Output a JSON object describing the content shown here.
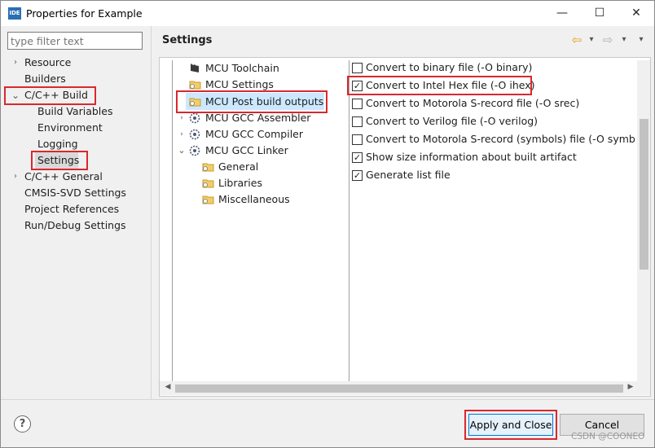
{
  "window": {
    "title": "Properties for Example",
    "app_icon": "IDE",
    "minimize_glyph": "—",
    "maximize_glyph": "☐",
    "close_glyph": "✕"
  },
  "filter": {
    "placeholder": "type filter text"
  },
  "left_nav": [
    {
      "label": "Resource",
      "arrow": "›"
    },
    {
      "label": "Builders",
      "arrow": ""
    },
    {
      "label": "C/C++ Build",
      "arrow": "⌄"
    },
    {
      "label": "Build Variables",
      "arrow": ""
    },
    {
      "label": "Environment",
      "arrow": ""
    },
    {
      "label": "Logging",
      "arrow": ""
    },
    {
      "label": "Settings",
      "arrow": ""
    },
    {
      "label": "C/C++ General",
      "arrow": "›"
    },
    {
      "label": "CMSIS-SVD Settings",
      "arrow": ""
    },
    {
      "label": "Project References",
      "arrow": ""
    },
    {
      "label": "Run/Debug Settings",
      "arrow": ""
    }
  ],
  "settings": {
    "title": "Settings",
    "back_glyph": "⇦",
    "forward_glyph": "⇨",
    "menu_glyph": "▾"
  },
  "tree": [
    {
      "label": "MCU Toolchain",
      "icon": "chip-icon",
      "arrow": ""
    },
    {
      "label": "MCU Settings",
      "icon": "folder-icon",
      "arrow": ""
    },
    {
      "label": "MCU Post build outputs",
      "icon": "folder-icon",
      "arrow": ""
    },
    {
      "label": "MCU GCC Assembler",
      "icon": "gear-icon",
      "arrow": "›"
    },
    {
      "label": "MCU GCC Compiler",
      "icon": "gear-icon",
      "arrow": "›"
    },
    {
      "label": "MCU GCC Linker",
      "icon": "gear-icon",
      "arrow": "⌄"
    },
    {
      "label": "General",
      "icon": "folder-icon",
      "arrow": ""
    },
    {
      "label": "Libraries",
      "icon": "folder-icon",
      "arrow": ""
    },
    {
      "label": "Miscellaneous",
      "icon": "folder-icon",
      "arrow": ""
    }
  ],
  "options": [
    {
      "label": "Convert to binary file (-O binary)",
      "checked": false
    },
    {
      "label": "Convert to Intel Hex file (-O ihex)",
      "checked": true
    },
    {
      "label": "Convert to Motorola S-record file (-O srec)",
      "checked": false
    },
    {
      "label": "Convert to Verilog file (-O verilog)",
      "checked": false
    },
    {
      "label": "Convert to Motorola S-record (symbols) file (-O symbolsr",
      "checked": false
    },
    {
      "label": "Show size information about built artifact",
      "checked": true
    },
    {
      "label": "Generate list file",
      "checked": true
    }
  ],
  "check_glyph": "✓",
  "buttons": {
    "help": "?",
    "apply_close": "Apply and Close",
    "cancel": "Cancel"
  },
  "watermark": "CSDN @COONEO",
  "colors": {
    "highlight_red": "#d9282f",
    "selection": "#cce8ff",
    "primary_border": "#0078d7"
  }
}
